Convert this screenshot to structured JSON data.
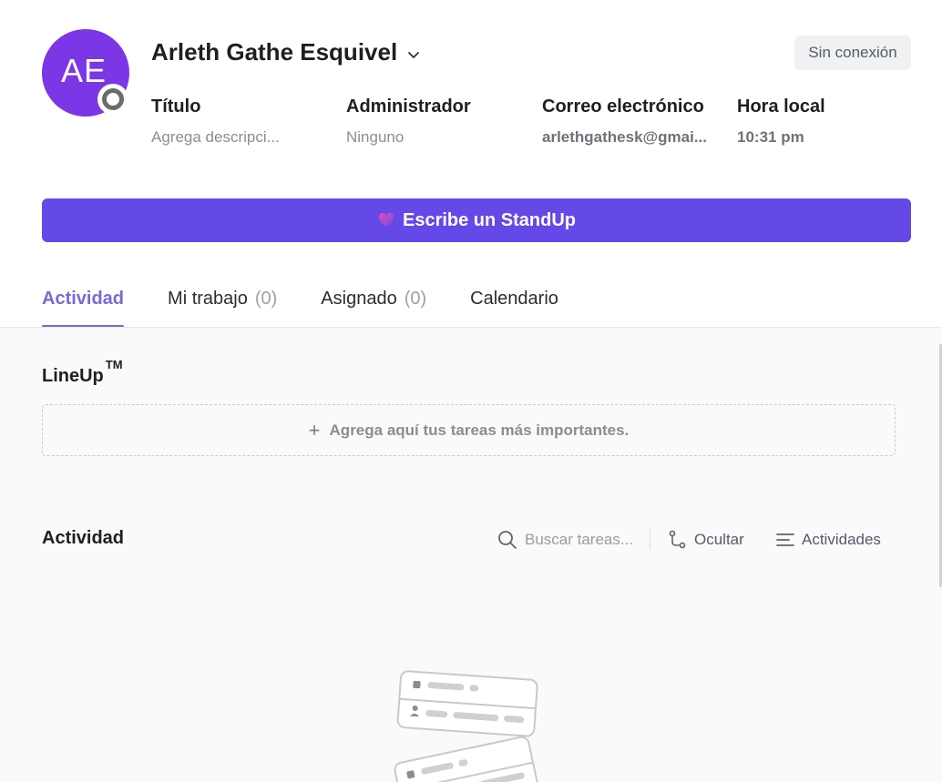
{
  "profile": {
    "initials": "AE",
    "name": "Arleth Gathe Esquivel",
    "status": "Sin conexión",
    "fields": [
      {
        "label": "Título",
        "value": "Agrega descripci..."
      },
      {
        "label": "Administrador",
        "value": "Ninguno"
      },
      {
        "label": "Correo electrónico",
        "value": "arlethgathesk@gmai..."
      },
      {
        "label": "Hora local",
        "value": "10:31 pm"
      }
    ]
  },
  "standup": {
    "label": "Escribe un StandUp"
  },
  "tabs": [
    {
      "label": "Actividad"
    },
    {
      "label": "Mi trabajo",
      "count": "(0)"
    },
    {
      "label": "Asignado",
      "count": "(0)"
    },
    {
      "label": "Calendario"
    }
  ],
  "lineup": {
    "title": "LineUp",
    "trademark": "TM",
    "add_label": "Agrega aquí tus tareas más importantes."
  },
  "activity": {
    "title": "Actividad",
    "search_placeholder": "Buscar tareas...",
    "hide_label": "Ocultar",
    "activities_label": "Actividades"
  },
  "colors": {
    "avatar": "#7b36e6",
    "primary_button": "#6448e8",
    "active_tab": "#7b68d8"
  },
  "icons": [
    "chevron-down-icon",
    "heart-icon",
    "plus-icon",
    "search-icon",
    "branch-icon",
    "filter-lines-icon"
  ]
}
